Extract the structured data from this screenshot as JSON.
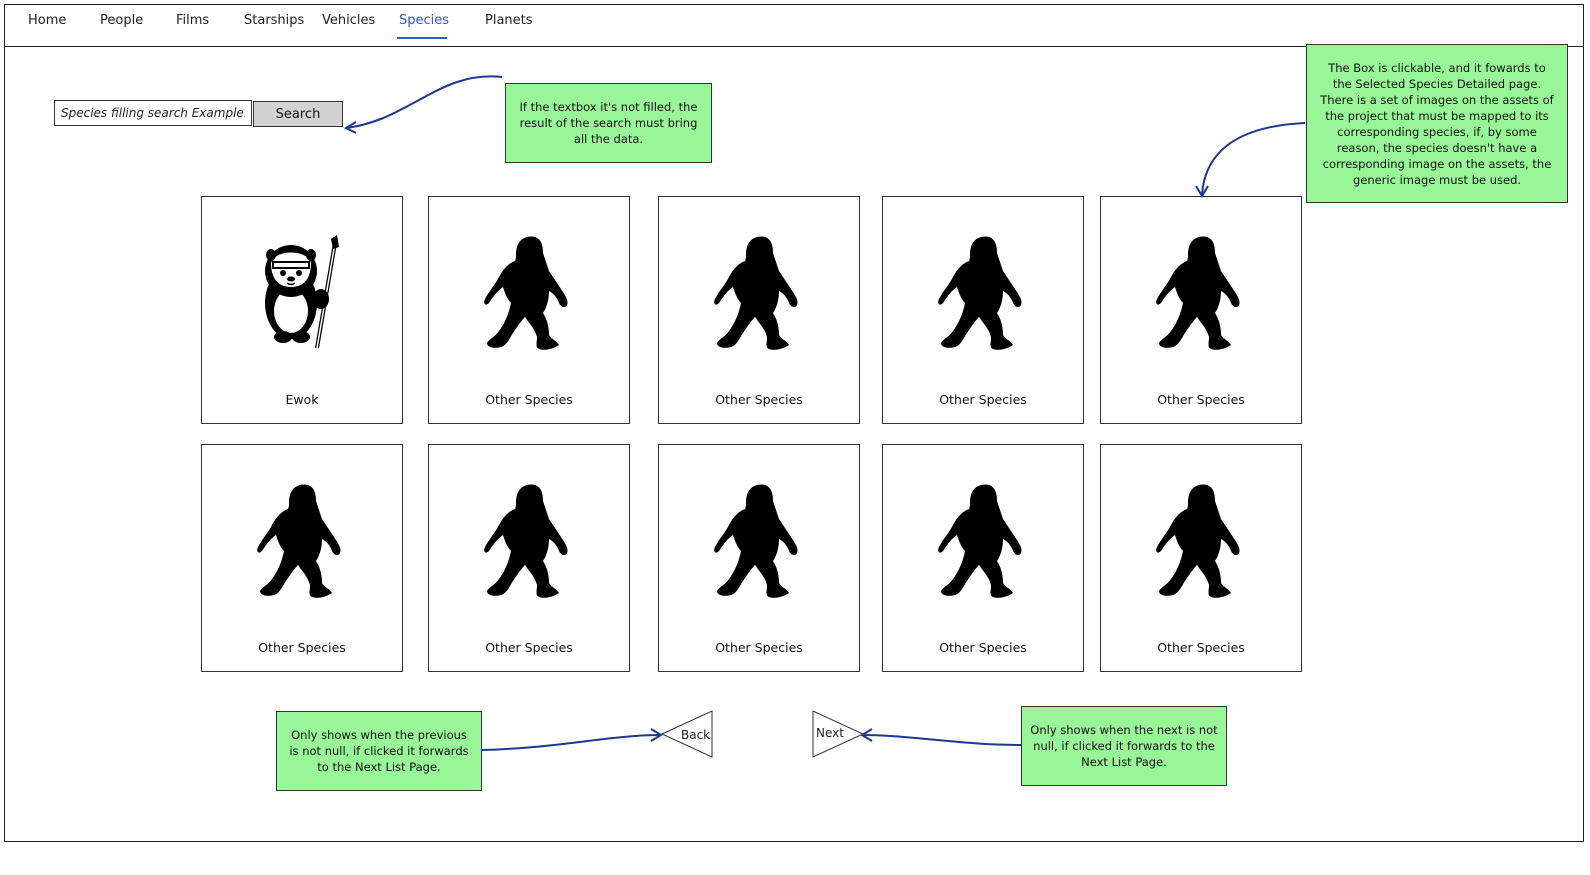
{
  "nav": {
    "items": [
      {
        "label": "Home",
        "active": false
      },
      {
        "label": "People",
        "active": false
      },
      {
        "label": "Films",
        "active": false
      },
      {
        "label": "Starships",
        "active": false
      },
      {
        "label": "Vehicles",
        "active": false
      },
      {
        "label": "Species",
        "active": true
      },
      {
        "label": "Planets",
        "active": false
      }
    ],
    "active_color": "#2d5bd8"
  },
  "search": {
    "placeholder": "Species filling search Example...",
    "value": "",
    "button_label": "Search"
  },
  "notes": {
    "search_note": "If the textbox it's not filled, the result of the search must bring all the data.",
    "box_note": "The Box is clickable, and it fowards to the Selected Species Detailed page. There is a set of images on the assets of the project that must be mapped to its corresponding species, if, by some reason, the species doesn't have a corresponding image on the assets, the generic image must be used.",
    "back_note": "Only shows when the previous is not null, if clicked it forwards to the Next List Page.",
    "next_note": "Only shows when the next is not null, if clicked it forwards to the Next List Page.",
    "color": "#98f598"
  },
  "species_cards": [
    {
      "name": "Ewok",
      "icon": "ewok-icon"
    },
    {
      "name": "Other Species",
      "icon": "bigfoot-silhouette-icon"
    },
    {
      "name": "Other Species",
      "icon": "bigfoot-silhouette-icon"
    },
    {
      "name": "Other Species",
      "icon": "bigfoot-silhouette-icon"
    },
    {
      "name": "Other Species",
      "icon": "bigfoot-silhouette-icon"
    },
    {
      "name": "Other Species",
      "icon": "bigfoot-silhouette-icon"
    },
    {
      "name": "Other Species",
      "icon": "bigfoot-silhouette-icon"
    },
    {
      "name": "Other Species",
      "icon": "bigfoot-silhouette-icon"
    },
    {
      "name": "Other Species",
      "icon": "bigfoot-silhouette-icon"
    },
    {
      "name": "Other Species",
      "icon": "bigfoot-silhouette-icon"
    }
  ],
  "pagination": {
    "back_label": "Back",
    "next_label": "Next"
  },
  "arrow_color": "#1a3a8c"
}
